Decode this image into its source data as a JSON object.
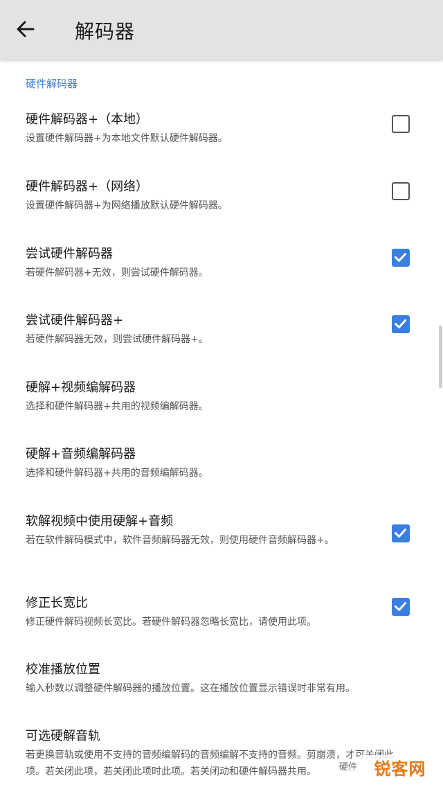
{
  "header": {
    "title": "解码器"
  },
  "section": {
    "label": "硬件解码器"
  },
  "items": [
    {
      "title": "硬件解码器+（本地）",
      "subtitle": "设置硬件解码器+为本地文件默认硬件解码器。",
      "checked": false
    },
    {
      "title": "硬件解码器+（网络）",
      "subtitle": "设置硬件解码器+为网络播放默认硬件解码器。",
      "checked": false
    },
    {
      "title": "尝试硬件解码器",
      "subtitle": "若硬件解码器+无效，则尝试硬件解码器。",
      "checked": true
    },
    {
      "title": "尝试硬件解码器+",
      "subtitle": "若硬件解码器无效，则尝试硬件解码器+。",
      "checked": true
    },
    {
      "title": "硬解+视频编解码器",
      "subtitle": "选择和硬件解码器+共用的视频编解码器。"
    },
    {
      "title": "硬解+音频编解码器",
      "subtitle": "选择和硬件解码器+共用的音频编解码器。"
    },
    {
      "title": "软解视频中使用硬解+音频",
      "subtitle": "若在软件解码模式中，软件音频解码器无效，则使用硬件音频解码器+。",
      "checked": true
    },
    {
      "title": "修正长宽比",
      "subtitle": "修正硬件解码视频长宽比。若硬件解码器忽略长宽比，请使用此项。",
      "checked": true
    },
    {
      "title": "校准播放位置",
      "subtitle": "输入秒数以调整硬件解码器的播放位置。这在播放位置显示错误时非常有用。"
    },
    {
      "title": "可选硬解音轨",
      "subtitle": "若更换音轨或使用不支持的音频编解码的音频编解不支持的音频。剪崩溃，才可关闭此项。若关闭此项，若关闭此项时此项。若关闭动和硬件解码器共用。"
    }
  ],
  "overlay": {
    "text": "硬件"
  },
  "watermark": {
    "text": "锐客网"
  },
  "colors": {
    "accent": "#3a7ee0",
    "appbar": "#e3e3e3",
    "section": "#3d82d8"
  }
}
